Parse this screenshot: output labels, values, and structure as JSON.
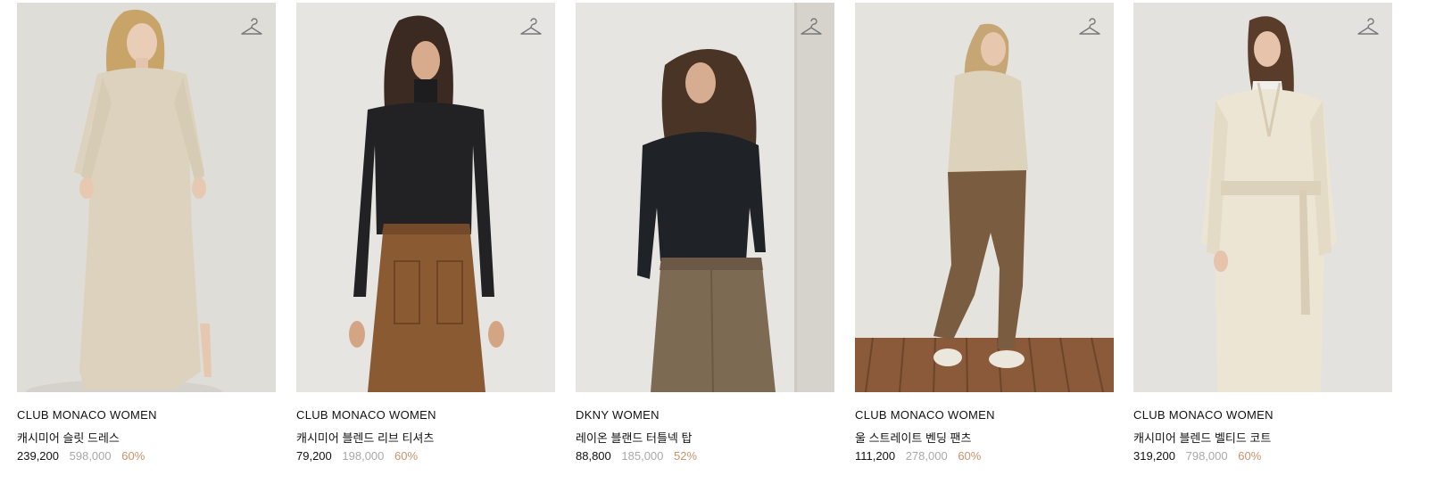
{
  "products": [
    {
      "brand": "CLUB MONACO WOMEN",
      "name": "캐시미어 슬릿 드레스",
      "sale_price": "239,200",
      "original_price": "598,000",
      "discount": "60%",
      "icon": "hanger-icon",
      "photo": "woman in beige cashmere knit dress"
    },
    {
      "brand": "CLUB MONACO WOMEN",
      "name": "캐시미어 블렌드 리브 티셔츠",
      "sale_price": "79,200",
      "original_price": "198,000",
      "discount": "60%",
      "icon": "hanger-icon",
      "photo": "woman in black ribbed turtleneck and brown leather skirt"
    },
    {
      "brand": "DKNY WOMEN",
      "name": "레이온 블랜드 터틀넥 탑",
      "sale_price": "88,800",
      "original_price": "185,000",
      "discount": "52%",
      "icon": "hanger-icon",
      "photo": "woman in black turtleneck and brown trousers"
    },
    {
      "brand": "CLUB MONACO WOMEN",
      "name": "울 스트레이트 벤딩 팬츠",
      "sale_price": "111,200",
      "original_price": "278,000",
      "discount": "60%",
      "icon": "hanger-icon",
      "photo": "woman in beige hoodie and brown wide pants"
    },
    {
      "brand": "CLUB MONACO WOMEN",
      "name": "캐시미어 블렌드 벨티드 코트",
      "sale_price": "319,200",
      "original_price": "798,000",
      "discount": "60%",
      "icon": "hanger-icon",
      "photo": "woman in cream belted long coat"
    }
  ],
  "colors": {
    "sale_price": "#111111",
    "original_price": "#a9a9a9",
    "discount": "#c9936b",
    "photo_bg": "#e3e1dd"
  }
}
